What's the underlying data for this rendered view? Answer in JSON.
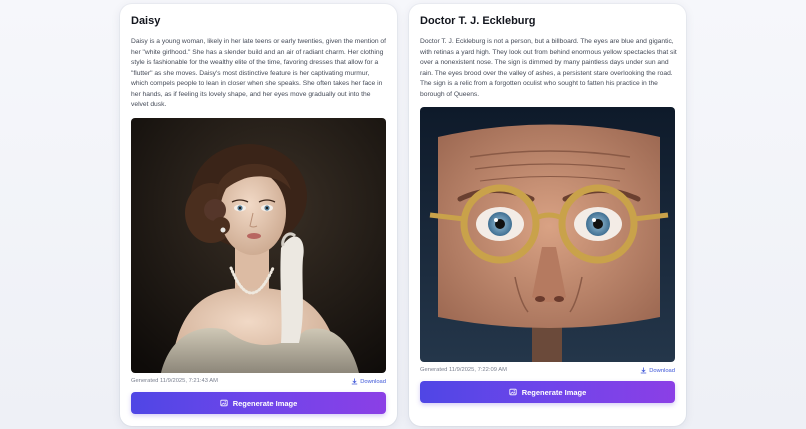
{
  "cards": [
    {
      "title": "Daisy",
      "description": "Daisy is a young woman, likely in her late teens or early twenties, given the mention of her \"white girlhood.\" She has a slender build and an air of radiant charm. Her clothing style is fashionable for the wealthy elite of the time, favoring dresses that allow for a \"flutter\" as she moves. Daisy's most distinctive feature is her captivating murmur, which compels people to lean in closer when she speaks. She often takes her face in her hands, as if feeling its lovely shape, and her eyes move gradually out into the velvet dusk.",
      "image_subject": "portrait of a young 1920s woman with pearl necklace",
      "generated": "Generated 11/9/2025, 7:21:43 AM",
      "download_label": "Download",
      "regenerate_label": "Regenerate Image"
    },
    {
      "title": "Doctor T. J. Eckleburg",
      "description": "Doctor T. J. Eckleburg is not a person, but a billboard. The eyes are blue and gigantic, with retinas a yard high. They look out from behind enormous yellow spectacles that sit over a nonexistent nose. The sign is dimmed by many paintless days under sun and rain. The eyes brood over the valley of ashes, a persistent stare overlooking the road. The sign is a relic from a forgotten oculist who sought to fatten his practice in the borough of Queens.",
      "image_subject": "billboard of giant eyes behind yellow spectacles",
      "generated": "Generated 11/9/2025, 7:22:09 AM",
      "download_label": "Download",
      "regenerate_label": "Regenerate Image"
    }
  ],
  "icons": {
    "download": "download-icon",
    "regenerate": "image-icon"
  },
  "colors": {
    "accent_start": "#4f46e5",
    "accent_end": "#8b3fe6",
    "link": "#3d56d8"
  }
}
